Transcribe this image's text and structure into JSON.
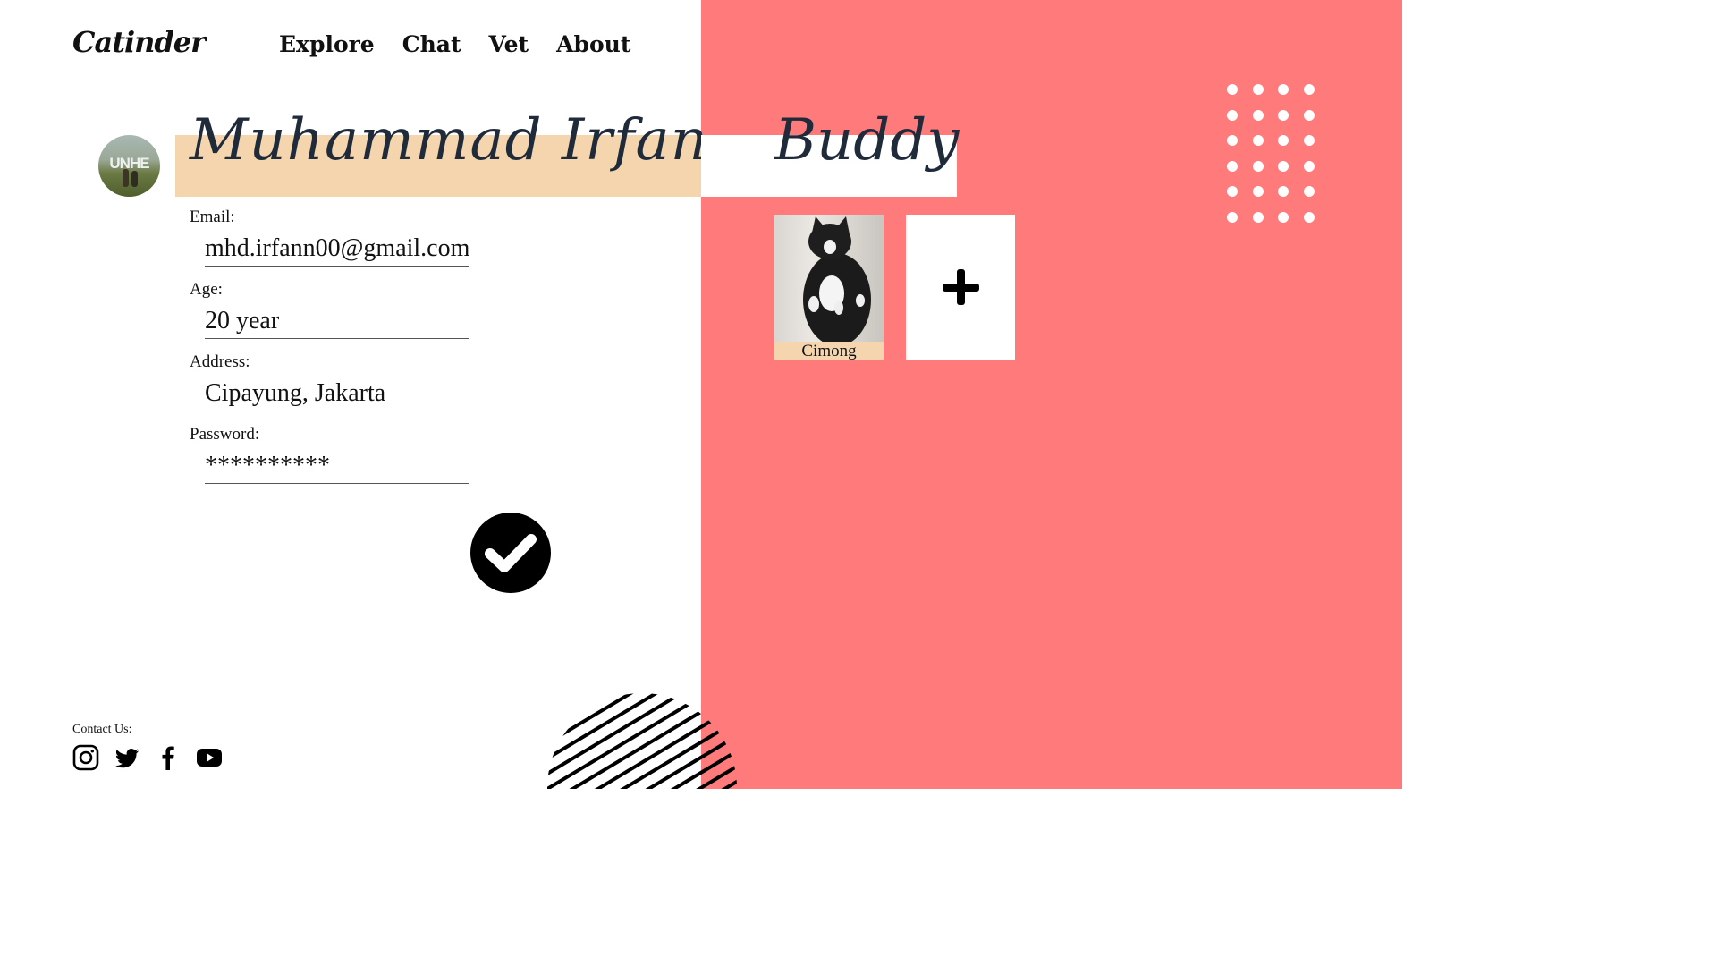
{
  "brand": {
    "logo_text": "Catinder"
  },
  "nav": {
    "items": [
      "Explore",
      "Chat",
      "Vet",
      "About"
    ]
  },
  "profile": {
    "name": "Muhammad Irfan",
    "fields": [
      {
        "label": "Email:",
        "value": "mhd.irfann00@gmail.com"
      },
      {
        "label": "Age:",
        "value": "20 year"
      },
      {
        "label": "Address:",
        "value": "Cipayung, Jakarta"
      },
      {
        "label": "Password:",
        "value": "**********"
      }
    ]
  },
  "buddy": {
    "title": "Buddy",
    "pets": [
      {
        "name": "Cimong"
      }
    ]
  },
  "footer": {
    "contact_label": "Contact Us:"
  },
  "icons": {
    "avatar": "profile-avatar",
    "confirm": "check-icon",
    "add": "plus-icon",
    "social": [
      "instagram-icon",
      "twitter-icon",
      "facebook-icon",
      "youtube-icon"
    ]
  },
  "colors": {
    "right_panel": "#ff7b7b",
    "name_band": "#f5d5ad",
    "text": "#111111"
  }
}
